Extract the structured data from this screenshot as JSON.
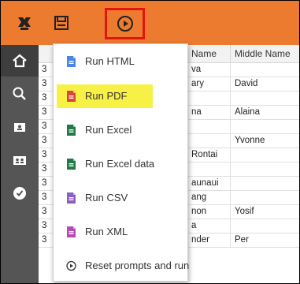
{
  "toolbar": {
    "buttons": [
      {
        "icon": "puzzle-tools-icon"
      },
      {
        "icon": "save-icon"
      },
      {
        "icon": "run-play-icon",
        "highlighted": true
      }
    ]
  },
  "sidebar": {
    "items": [
      {
        "icon": "home-icon",
        "active": true
      },
      {
        "icon": "search-icon"
      },
      {
        "icon": "personal-folder-icon"
      },
      {
        "icon": "team-folder-icon"
      },
      {
        "icon": "recent-clock-icon"
      }
    ]
  },
  "grid": {
    "headers": {
      "name": "Name",
      "middle": "Middle Name"
    },
    "rows": [
      {
        "num": "3",
        "name": "va",
        "middle": ""
      },
      {
        "num": "3",
        "name": "ary",
        "middle": "David"
      },
      {
        "num": "3",
        "name": "",
        "middle": ""
      },
      {
        "num": "3",
        "name": "na",
        "middle": "Alaina"
      },
      {
        "num": "3",
        "name": "",
        "middle": ""
      },
      {
        "num": "3",
        "name": "",
        "middle": "Yvonne"
      },
      {
        "num": "3",
        "name": "Rontai",
        "middle": ""
      },
      {
        "num": "3",
        "name": "",
        "middle": ""
      },
      {
        "num": "3",
        "name": "aunaui",
        "middle": ""
      },
      {
        "num": "3",
        "name": "ang",
        "middle": ""
      },
      {
        "num": "3",
        "name": "non",
        "middle": "Yosif"
      },
      {
        "num": "3",
        "name": "a",
        "middle": ""
      },
      {
        "num": "3",
        "name": "nder",
        "middle": "Per"
      }
    ]
  },
  "menu": {
    "items": [
      {
        "label": "Run HTML",
        "icon": "html-file-icon",
        "color": "#4a86e8"
      },
      {
        "label": "Run PDF",
        "icon": "pdf-file-icon",
        "color": "#e0433b",
        "highlighted": true
      },
      {
        "label": "Run Excel",
        "icon": "excel-file-icon",
        "color": "#1e7b45"
      },
      {
        "label": "Run Excel data",
        "icon": "excel-data-file-icon",
        "color": "#1e7b45"
      },
      {
        "label": "Run CSV",
        "icon": "csv-file-icon",
        "color": "#8b5fc2"
      },
      {
        "label": "Run XML",
        "icon": "xml-file-icon",
        "color": "#b44ab4"
      },
      {
        "label": "Reset prompts and run",
        "icon": "reset-run-icon",
        "color": "#333333"
      }
    ]
  },
  "colors": {
    "toolbar": "#ec7b30",
    "sidebar": "#555555",
    "highlight_border": "#e3150f",
    "highlight_fill": "#f7f045"
  }
}
